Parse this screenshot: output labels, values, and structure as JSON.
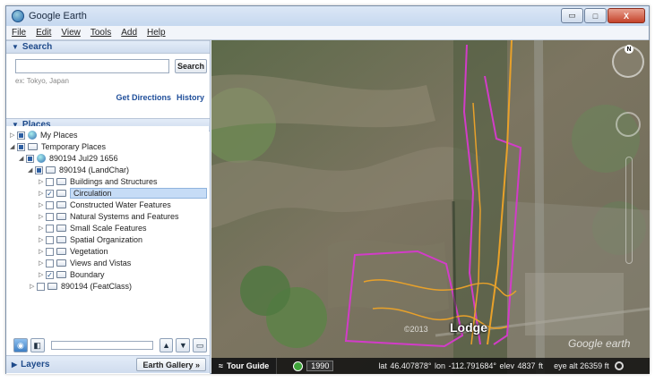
{
  "window": {
    "title": "Google Earth",
    "controls": {
      "minimize": "▭",
      "maximize": "□",
      "close": "X"
    }
  },
  "menu": [
    "File",
    "Edit",
    "View",
    "Tools",
    "Add",
    "Help"
  ],
  "search": {
    "header": "Search",
    "input_value": "",
    "button": "Search",
    "hint": "ex: Tokyo, Japan",
    "get_directions": "Get Directions",
    "history": "History"
  },
  "places": {
    "header": "Places",
    "nodes": [
      {
        "label": "My Places",
        "icon": "globe-icon"
      },
      {
        "label": "Temporary Places",
        "icon": "folder-icon"
      },
      {
        "label": "890194 Jul29 1656",
        "icon": "globe-icon"
      },
      {
        "label": "890194 (LandChar)",
        "icon": "folder-icon"
      },
      {
        "label": "Buildings and Structures",
        "icon": "folder-icon"
      },
      {
        "label": "Circulation",
        "icon": "folder-icon",
        "checked": true,
        "selected": true
      },
      {
        "label": "Constructed Water Features",
        "icon": "folder-icon"
      },
      {
        "label": "Natural Systems and Features",
        "icon": "folder-icon"
      },
      {
        "label": "Small Scale Features",
        "icon": "folder-icon"
      },
      {
        "label": "Spatial Organization",
        "icon": "folder-icon"
      },
      {
        "label": "Vegetation",
        "icon": "folder-icon"
      },
      {
        "label": "Views and Vistas",
        "icon": "folder-icon"
      },
      {
        "label": "Boundary",
        "icon": "folder-icon",
        "checked": true
      },
      {
        "label": "890194 (FeatClass)",
        "icon": "folder-icon"
      }
    ]
  },
  "toolbar": {
    "up": "▲",
    "down": "▼",
    "export": "▭"
  },
  "layers": {
    "header": "Layers",
    "gallery_button": "Earth Gallery »"
  },
  "map": {
    "place_label": "Lodge",
    "copyright": "©2013",
    "watermark": "Google earth",
    "compass_label": "N"
  },
  "status": {
    "tour_guide": "Tour Guide",
    "year": "1990",
    "lat": "lat  46.407878°",
    "lon": "lon -112.791684°",
    "elev": "elev  4837 ft",
    "eye_alt": "eye alt  26359 ft"
  },
  "colors": {
    "boundary": "#d23cc8",
    "circulation": "#e8a12a",
    "accent": "#1e4a8a"
  }
}
